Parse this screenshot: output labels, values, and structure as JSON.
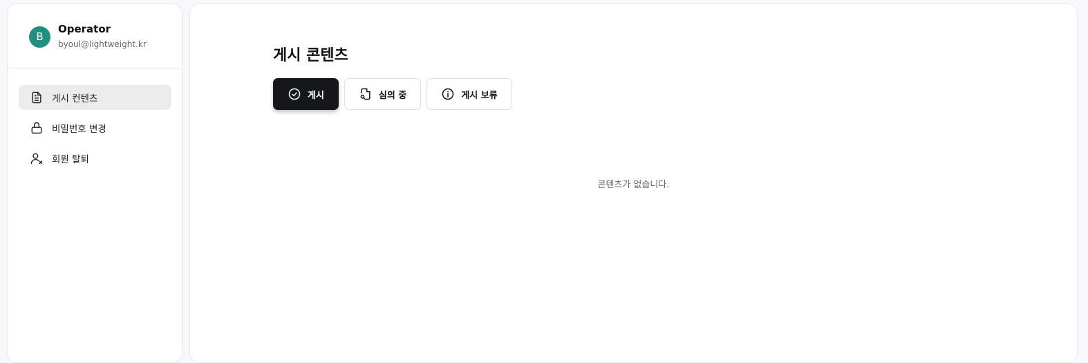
{
  "profile": {
    "initial": "B",
    "name": "Operator",
    "email": "byoul@lightweight.kr",
    "avatar_color": "#1f8f7f"
  },
  "sidebar": {
    "items": [
      {
        "label": "게시 컨텐츠",
        "icon": "document-icon",
        "active": true
      },
      {
        "label": "비밀번호 변경",
        "icon": "lock-icon",
        "active": false
      },
      {
        "label": "회원 탈퇴",
        "icon": "user-remove-icon",
        "active": false
      }
    ]
  },
  "main": {
    "title": "게시 콘텐츠",
    "tabs": [
      {
        "label": "게시",
        "icon": "check-circle-icon",
        "active": true
      },
      {
        "label": "심의 중",
        "icon": "file-search-icon",
        "active": false
      },
      {
        "label": "게시 보류",
        "icon": "info-circle-icon",
        "active": false
      }
    ],
    "empty_message": "콘텐츠가 없습니다."
  },
  "colors": {
    "accent_dark": "#16171a",
    "active_nav_bg": "#ececec",
    "page_bg": "#f6f8fb"
  }
}
